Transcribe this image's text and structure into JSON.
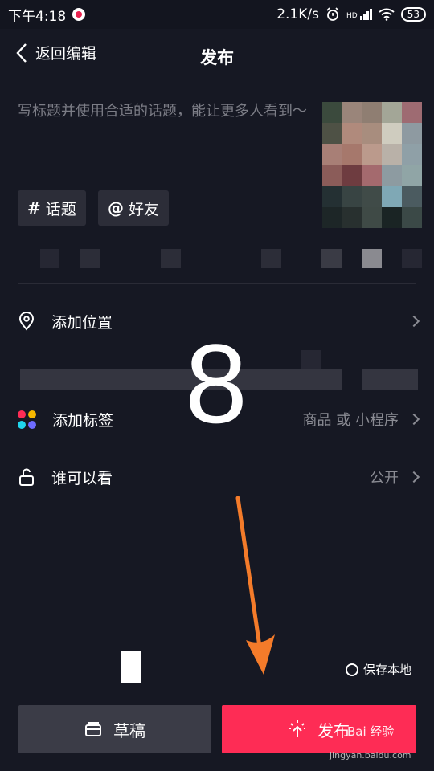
{
  "status_bar": {
    "time": "下午4:18",
    "network_speed": "2.1K/s",
    "signal_text": "HD",
    "battery": "53"
  },
  "header": {
    "back_label": "返回编辑",
    "title": "发布"
  },
  "description": {
    "placeholder": "写标题并使用合适的话题，能让更多人看到～"
  },
  "chips": [
    {
      "symbol": "#",
      "label": "话题"
    },
    {
      "symbol": "@",
      "label": "好友"
    }
  ],
  "rows": {
    "location": {
      "label": "添加位置"
    },
    "tags": {
      "label": "添加标签",
      "value": "商品 或 小程序"
    },
    "visibility": {
      "label": "谁可以看",
      "value": "公开"
    }
  },
  "overlay_number": "8",
  "save_local_label": "保存本地",
  "buttons": {
    "draft": "草稿",
    "publish": "发布"
  },
  "watermark": {
    "text": "Bai 经验",
    "url": "jingyan.baidu.com"
  },
  "thumbnail_colors": [
    "#3b4a3d",
    "#9a857a",
    "#8f7e72",
    "#a3a697",
    "#9e6b72",
    "#4e5145",
    "#b08a7c",
    "#a88d7e",
    "#cfccbf",
    "#8e9aa1",
    "#a87f76",
    "#a6786c",
    "#bb9a8c",
    "#b9b1a8",
    "#8fa0a7",
    "#8b5c59",
    "#6e3c40",
    "#a46a6e",
    "#8d9ba1",
    "#90a5a6",
    "#243033",
    "#384443",
    "#404b48",
    "#7fa8b5",
    "#4b5b60",
    "#1d2627",
    "#28302f",
    "#3f4a46",
    "#1a2424",
    "#3b4947"
  ],
  "colors": {
    "background": "#161823",
    "accent": "#fe2c55",
    "draft_button": "#3b3c47",
    "arrow": "#f47b2a"
  }
}
